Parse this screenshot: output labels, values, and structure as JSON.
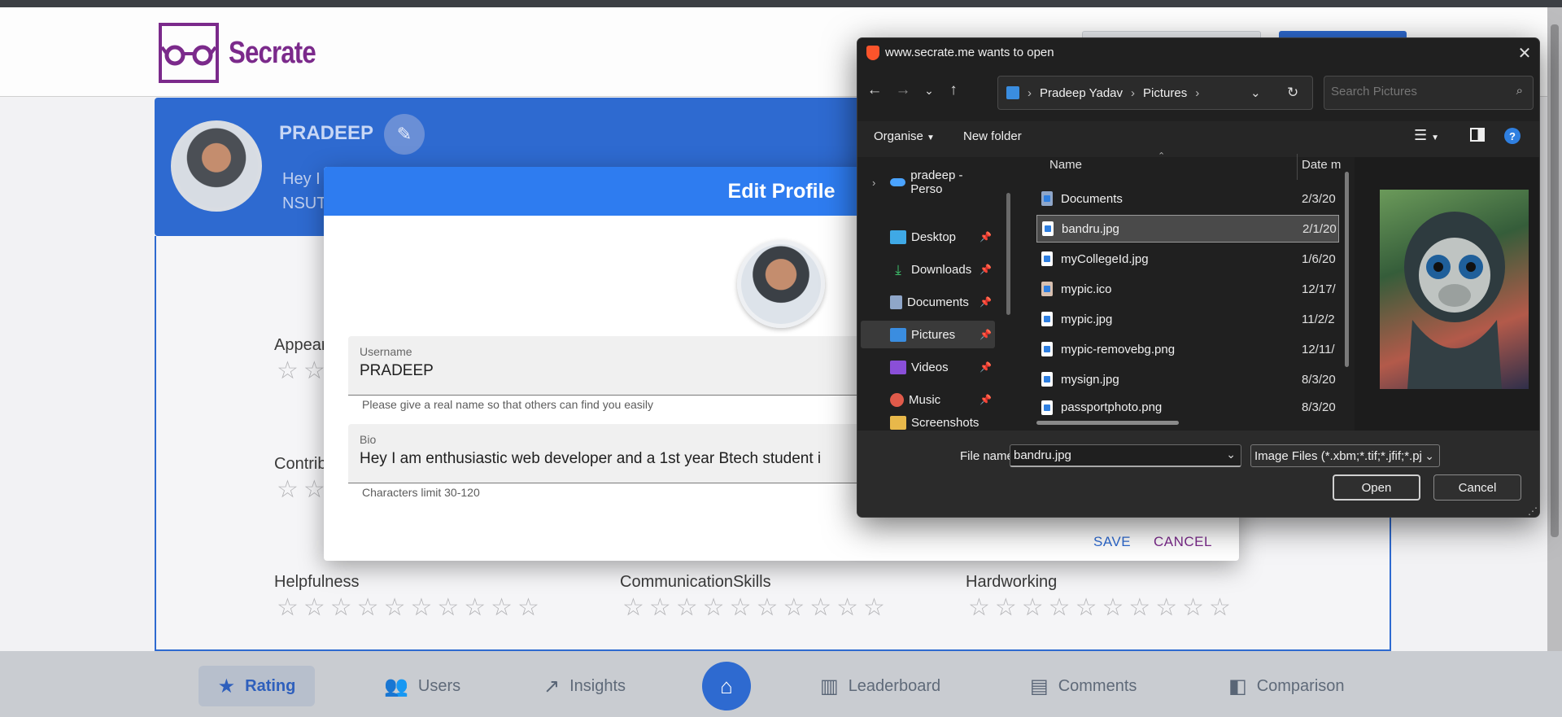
{
  "site": {
    "brand": "Secrate",
    "profile_name": "PRADEEP",
    "profile_bio_line1": "Hey I",
    "profile_bio_line2": "NSUT",
    "categories": [
      {
        "label": "Appear"
      },
      {
        "label": "Contrib"
      },
      {
        "label": "Helpfulness"
      },
      {
        "label": "CommunicationSkills"
      },
      {
        "label": "Hardworking"
      }
    ],
    "star_count": 10,
    "star_glyphs": "☆☆☆☆☆☆☆☆☆☆",
    "star_glyphs_short": "☆☆",
    "rating_values": {
      "appearance": 0,
      "contribution": 0,
      "helpfulness": 0,
      "communication_skills": 0,
      "hardworking": 0
    }
  },
  "bottom_nav": {
    "rating": "Rating",
    "users": "Users",
    "insights": "Insights",
    "leaderboard": "Leaderboard",
    "comments": "Comments",
    "comparison": "Comparison"
  },
  "edit_profile": {
    "title": "Edit Profile",
    "username_label": "Username",
    "username_value": "PRADEEP",
    "username_helper": "Please give a real name so that others can find you easily",
    "bio_label": "Bio",
    "bio_value": "Hey I am enthusiastic web developer and a 1st year Btech student i",
    "bio_helper": "Characters limit 30-120",
    "save": "SAVE",
    "cancel": "CANCEL"
  },
  "file_dialog": {
    "title": "www.secrate.me wants to open",
    "breadcrumb": [
      "Pradeep Yadav",
      "Pictures"
    ],
    "search_placeholder": "Search Pictures",
    "organise": "Organise",
    "new_folder": "New folder",
    "nav_items": [
      {
        "label": "pradeep - Perso",
        "icon": "onedrive-icon"
      },
      {
        "label": "Desktop",
        "icon": "desktop-icon"
      },
      {
        "label": "Downloads",
        "icon": "download-icon"
      },
      {
        "label": "Documents",
        "icon": "documents-icon"
      },
      {
        "label": "Pictures",
        "icon": "pictures-icon"
      },
      {
        "label": "Videos",
        "icon": "videos-icon"
      },
      {
        "label": "Music",
        "icon": "music-icon"
      },
      {
        "label": "Screenshots",
        "icon": "folder-icon"
      }
    ],
    "columns": {
      "name": "Name",
      "date": "Date m"
    },
    "files": [
      {
        "name": "Documents",
        "date": "2/3/20"
      },
      {
        "name": "bandru.jpg",
        "date": "2/1/20",
        "selected": true
      },
      {
        "name": "myCollegeId.jpg",
        "date": "1/6/20"
      },
      {
        "name": "mypic.ico",
        "date": "12/17/"
      },
      {
        "name": "mypic.jpg",
        "date": "11/2/2"
      },
      {
        "name": "mypic-removebg.png",
        "date": "12/11/"
      },
      {
        "name": "mysign.jpg",
        "date": "8/3/20"
      },
      {
        "name": "passportphoto.png",
        "date": "8/3/20"
      }
    ],
    "file_name_label": "File name:",
    "file_name_value": "bandru.jpg",
    "file_type": "Image Files (*.xbm;*.tif;*.jfif;*.pjp",
    "open": "Open",
    "cancel": "Cancel"
  },
  "colors": {
    "primary_blue": "#2e6ad0",
    "modal_header": "#2e7cf0",
    "brand_purple": "#7b2a8b",
    "cancel_purple": "#7b2a8b",
    "dialog_bg": "#202020"
  }
}
